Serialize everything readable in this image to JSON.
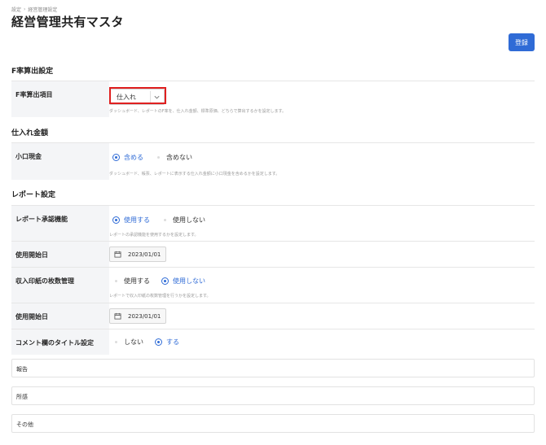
{
  "breadcrumb": {
    "items": [
      "設定",
      "経営管理設定"
    ],
    "separator": "›"
  },
  "page_title": "経営管理共有マスタ",
  "toolbar": {
    "save_label": "登録"
  },
  "sections": {
    "f_rate": {
      "title": "F率算出設定",
      "item_label": "F率算出項目",
      "select_value": "仕入れ",
      "help": "ダッシュボード、レポートのF率を、仕入れ金額、標準原価、どちらで算出するかを設定します。"
    },
    "purchase": {
      "title": "仕入れ金額",
      "petty_cash_label": "小口現金",
      "option_include": "含める",
      "option_exclude": "含めない",
      "help": "ダッシュボード、帳票、レポートに表示する仕入れ金額に小口現金を含めるかを設定します。"
    },
    "report": {
      "title": "レポート設定",
      "approval_label": "レポート承認機能",
      "approval_use": "使用する",
      "approval_not_use": "使用しない",
      "approval_help": "レポートの承認機能を使用するかを設定します。",
      "start_date_label": "使用開始日",
      "start_date_value": "2023/01/01",
      "stamp_label": "収入印紙の枚数管理",
      "stamp_use": "使用する",
      "stamp_not_use": "使用しない",
      "stamp_help": "レポートで収入印紙の枚数管理を行うかを設定します。",
      "stamp_start_label": "使用開始日",
      "stamp_start_value": "2023/01/01",
      "comment_title_label": "コメント欄のタイトル設定",
      "comment_no": "しない",
      "comment_yes": "する",
      "comment_fields": [
        "報告",
        "所感",
        "その他"
      ]
    }
  },
  "colors": {
    "accent": "#2f6bd6",
    "highlight": "#e02020",
    "label_bg": "#f4f5f7"
  }
}
